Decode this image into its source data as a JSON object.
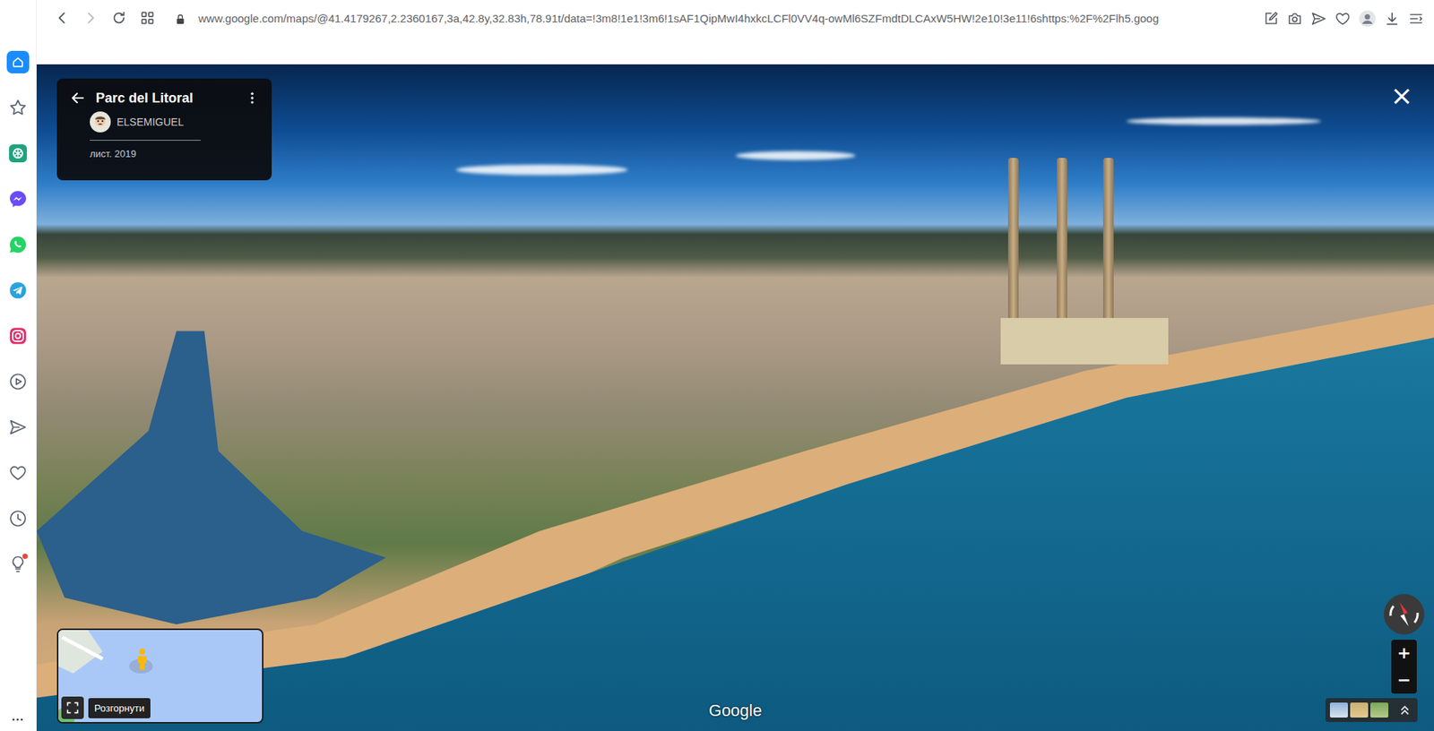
{
  "address_bar": {
    "url": "www.google.com/maps/@41.4179267,2.2360167,3a,42.8y,32.83h,78.91t/data=!3m8!1e1!3m6!1sAF1QipMwI4hxkcLCFl0VV4q-owMl6SZFmdtDLCAxW5HW!2e10!3e11!6shttps:%2F%2Flh5.goog"
  },
  "navigation": {
    "back": {
      "disabled": false
    },
    "forward": {
      "disabled": true
    }
  },
  "sidebar": {
    "items": [
      {
        "selected": true,
        "badge": false,
        "color": "#1a8cff"
      },
      {
        "selected": false,
        "badge": false,
        "color": "#5a6270"
      },
      {
        "selected": false,
        "badge": false,
        "color": "#1fa37f"
      },
      {
        "selected": false,
        "badge": false,
        "color": "#6a4cf5"
      },
      {
        "selected": false,
        "badge": false,
        "color": "#25d366"
      },
      {
        "selected": false,
        "badge": false,
        "color": "#2aa3dd"
      },
      {
        "selected": false,
        "badge": false,
        "color": "#e1306c"
      },
      {
        "selected": false,
        "badge": false,
        "color": "#5a6270"
      },
      {
        "selected": false,
        "badge": false,
        "color": "#5a6270"
      },
      {
        "selected": false,
        "badge": false,
        "color": "#5a6270"
      },
      {
        "selected": false,
        "badge": false,
        "color": "#5a6270"
      },
      {
        "selected": false,
        "badge": true,
        "color": "#5a6270"
      }
    ],
    "more": "..."
  },
  "viewer": {
    "title": "Parc del Litoral",
    "author": "ELSEMIGUEL",
    "date": "лист. 2019",
    "close": "×",
    "expand_tooltip": "Розгорнути",
    "watermark": "Google",
    "zoom_in": "+",
    "zoom_out": "−"
  }
}
